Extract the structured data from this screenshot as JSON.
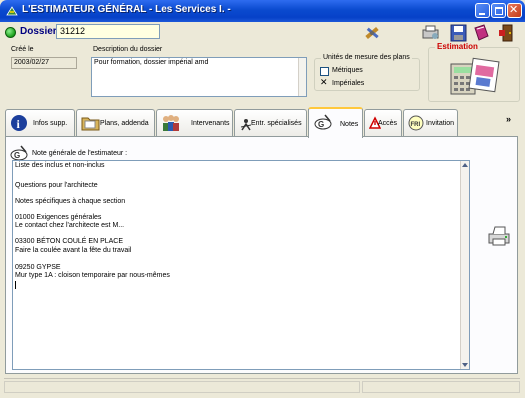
{
  "window": {
    "title": "L'ESTIMATEUR GÉNÉRAL  -  Les Services I.  -"
  },
  "toolbar": {
    "dossier_label": "Dossier",
    "dossier_number": "31212"
  },
  "fields": {
    "created_label": "Créé le",
    "created_date": "2003/02/27",
    "description_label": "Description du dossier",
    "description_value": "Pour formation, dossier impérial amd",
    "units_legend": "Unités de mesure des plans",
    "unit_metric": "Métriques",
    "unit_imperial": "Impériales",
    "unit_metric_checked": false,
    "unit_imperial_checked": true,
    "estimation_label": "Estimation"
  },
  "tabs": [
    {
      "label": "Infos supp.",
      "icon": "info-icon"
    },
    {
      "label": "Plans, addenda",
      "icon": "folder-icon"
    },
    {
      "label": "Intervenants",
      "icon": "people-icon"
    },
    {
      "label": "Entr. spécialisés",
      "icon": "worker-icon"
    },
    {
      "label": "Notes",
      "icon": "notes-icon"
    },
    {
      "label": "Accès",
      "icon": "warning-icon"
    },
    {
      "label": "Invitation",
      "icon": "invitation-icon"
    }
  ],
  "active_tab": "Notes",
  "notes": {
    "label": "Note générale de l'estimateur :",
    "lines": [
      "Liste des inclus et non-inclus",
      "",
      "Questions pour l'architecte",
      "",
      "Notes spécifiques à chaque section",
      "",
      "01000 Exigences générales",
      "Le contact chez l'architecte est M...",
      "",
      "03300 BÉTON COULÉ EN PLACE",
      "Faire la coulée avant la fête du travail",
      "",
      "09250 GYPSE",
      "Mur type 1A : cloison temporaire par nous-mêmes"
    ]
  }
}
